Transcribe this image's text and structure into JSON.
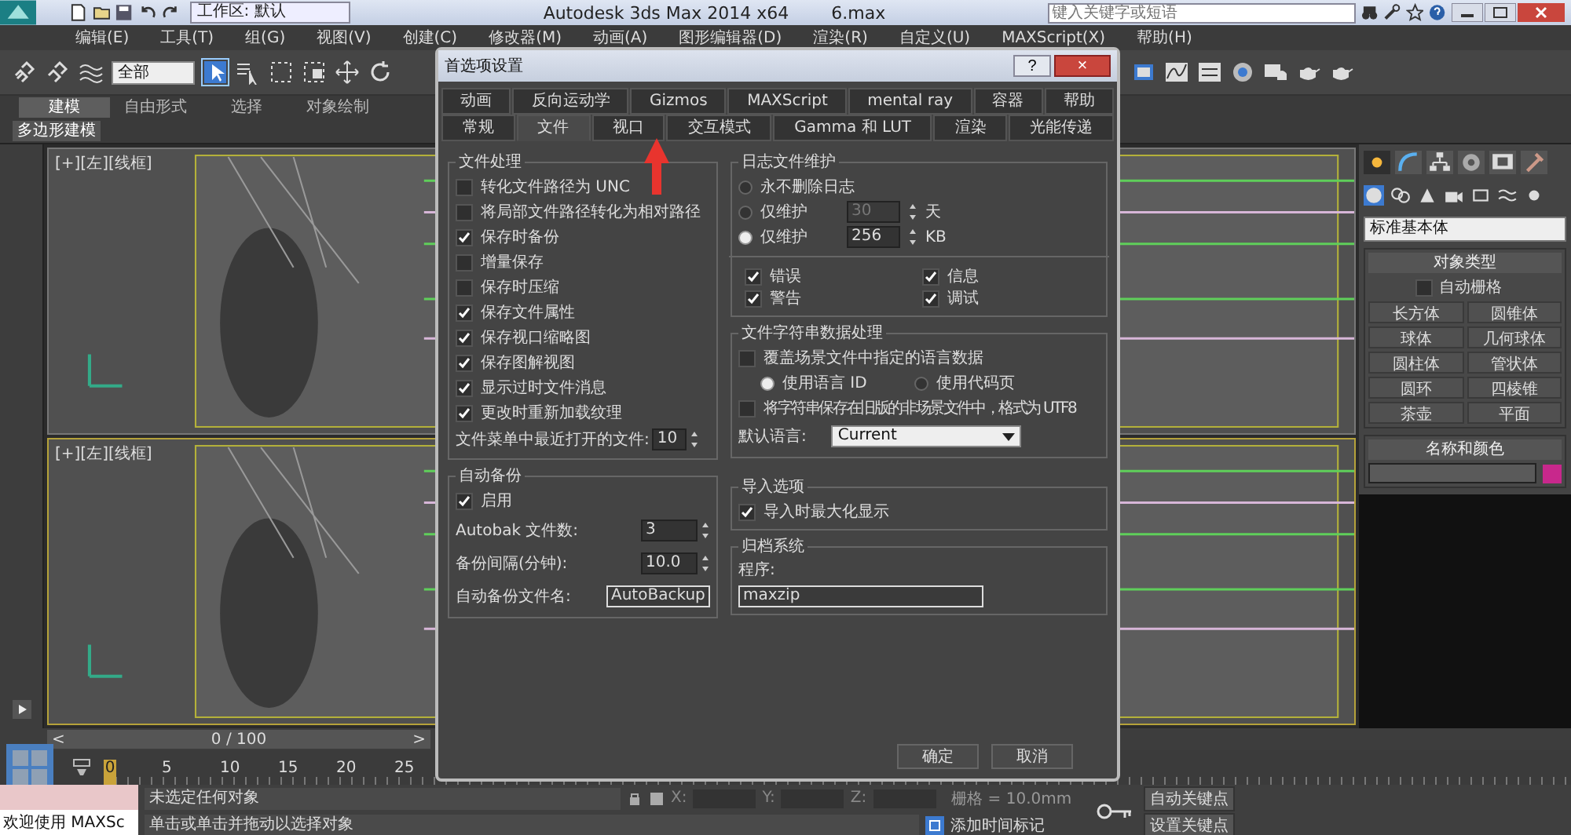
{
  "app": {
    "title": "Autodesk 3ds Max  2014 x64",
    "file": "6.max",
    "workspace": "工作区: 默认",
    "search_placeholder": "键入关键字或短语"
  },
  "menu": [
    "编辑(E)",
    "工具(T)",
    "组(G)",
    "视图(V)",
    "创建(C)",
    "修改器(M)",
    "动画(A)",
    "图形编辑器(D)",
    "渲染(R)",
    "自定义(U)",
    "MAXScript(X)",
    "帮助(H)"
  ],
  "toolbar": {
    "selection_filter": "全部"
  },
  "ribbon": {
    "tabs": [
      {
        "label": "建模",
        "selected": true
      },
      {
        "label": "自由形式",
        "selected": false
      },
      {
        "label": "选择",
        "selected": false
      },
      {
        "label": "对象绘制",
        "selected": false
      }
    ],
    "panel": "多边形建模"
  },
  "viewports": [
    {
      "label": "[+][左][线框]"
    },
    {
      "label": "[+][左][线框]"
    }
  ],
  "command_panel": {
    "dropdown": "标准基本体",
    "object_type": {
      "title": "对象类型",
      "autogrid": {
        "label": "自动栅格",
        "checked": false
      },
      "buttons": [
        "长方体",
        "圆锥体",
        "球体",
        "几何球体",
        "圆柱体",
        "管状体",
        "圆环",
        "四棱锥",
        "茶壶",
        "平面"
      ]
    },
    "name_color": {
      "title": "名称和颜色"
    }
  },
  "timeline": {
    "level": 0,
    "frame": "0 / 100",
    "prev": "<",
    "next": ">",
    "ticks": [
      "0",
      "5",
      "10",
      "15",
      "20",
      "25"
    ]
  },
  "status": {
    "script_listener": "欢迎使用 MAXSc",
    "selection": "未选定任何对象",
    "prompt": "单击或单击并拖动以选择对象",
    "coords": [
      "X:",
      "Y:",
      "Z:"
    ],
    "grid": "栅格 = 10.0mm",
    "time_tag": "添加时间标记",
    "auto_key": "自动关键点",
    "set_key": "设置关键点"
  },
  "dialog": {
    "title": "首选项设置",
    "help": "?",
    "close": "×",
    "tab_rows": [
      [
        {
          "label": "动画",
          "selected": false
        },
        {
          "label": "反向运动学",
          "selected": false
        },
        {
          "label": "Gizmos",
          "selected": false
        },
        {
          "label": "MAXScript",
          "selected": false
        },
        {
          "label": "mental ray",
          "selected": false
        },
        {
          "label": "容器",
          "selected": false
        },
        {
          "label": "帮助",
          "selected": false
        }
      ],
      [
        {
          "label": "常规",
          "selected": false
        },
        {
          "label": "文件",
          "selected": true
        },
        {
          "label": "视口",
          "selected": false
        },
        {
          "label": "交互模式",
          "selected": false
        },
        {
          "label": "Gamma 和 LUT",
          "selected": false
        },
        {
          "label": "渲染",
          "selected": false
        },
        {
          "label": "光能传递",
          "selected": false
        }
      ]
    ],
    "file_handling": {
      "title": "文件处理",
      "options": [
        {
          "label": "转化文件路径为 UNC",
          "checked": false
        },
        {
          "label": "将局部文件路径转化为相对路径",
          "checked": false
        },
        {
          "label": "保存时备份",
          "checked": true
        },
        {
          "label": "增量保存",
          "checked": false
        },
        {
          "label": "保存时压缩",
          "checked": false
        },
        {
          "label": "保存文件属性",
          "checked": true
        },
        {
          "label": "保存视口缩略图",
          "checked": true
        },
        {
          "label": "保存图解视图",
          "checked": true
        },
        {
          "label": "显示过时文件消息",
          "checked": true
        },
        {
          "label": "更改时重新加载纹理",
          "checked": true
        }
      ],
      "recent_label": "文件菜单中最近打开的文件:",
      "recent_value": "10"
    },
    "auto_backup": {
      "title": "自动备份",
      "enable": {
        "label": "启用",
        "checked": true
      },
      "count_label": "Autobak 文件数:",
      "count": "3",
      "interval_label": "备份间隔(分钟):",
      "interval": "10.0",
      "name_label": "自动备份文件名:",
      "name": "AutoBackup"
    },
    "log": {
      "title": "日志文件维护",
      "modes": [
        {
          "label": "永不删除日志",
          "selected": false
        },
        {
          "label": "仅维护",
          "selected": false,
          "value": "30",
          "unit": "天"
        },
        {
          "label": "仅维护",
          "selected": true,
          "value": "256",
          "unit": "KB"
        }
      ],
      "levels": [
        {
          "label": "错误",
          "checked": true
        },
        {
          "label": "信息",
          "checked": true
        },
        {
          "label": "警告",
          "checked": true
        },
        {
          "label": "调试",
          "checked": true
        }
      ]
    },
    "strings": {
      "title": "文件字符串数据处理",
      "override": {
        "label": "覆盖场景文件中指定的语言数据",
        "checked": false
      },
      "sources": [
        {
          "label": "使用语言 ID",
          "selected": true
        },
        {
          "label": "使用代码页",
          "selected": false
        }
      ],
      "legacy_utf8": {
        "label": "将字符串保存在旧版的非场景文件中，格式为 UTF8",
        "checked": false
      },
      "language_label": "默认语言:",
      "language": "Current"
    },
    "import": {
      "title": "导入选项",
      "maximize": {
        "label": "导入时最大化显示",
        "checked": true
      }
    },
    "archive": {
      "title": "归档系统",
      "program_label": "程序:",
      "program": "maxzip"
    },
    "buttons": [
      "确定",
      "取消"
    ]
  }
}
